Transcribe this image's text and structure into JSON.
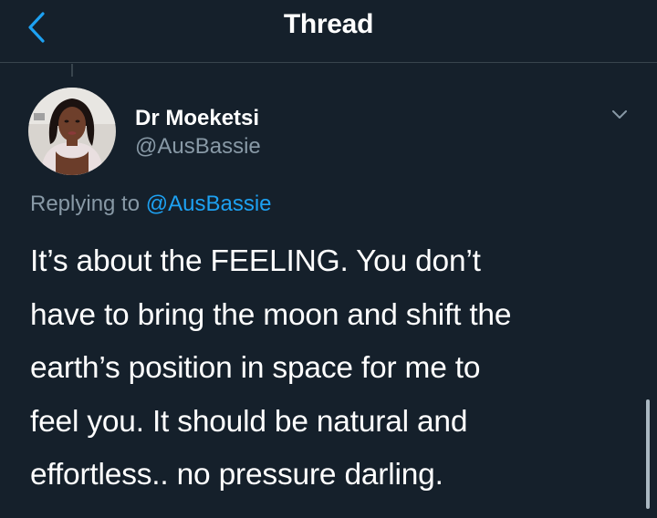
{
  "header": {
    "title": "Thread",
    "back_icon": "chevron-left-icon"
  },
  "tweet": {
    "author": {
      "display_name": "Dr Moeketsi",
      "handle": "@AusBassie"
    },
    "reply": {
      "prefix": "Replying to ",
      "to": "@AusBassie"
    },
    "text": "It’s about the FEELING. You don’t\nhave to bring the moon and shift the\nearth’s position in space for me to\nfeel you. It should be natural and\neffortless.. no pressure darling.",
    "menu_icon": "chevron-down-icon"
  },
  "colors": {
    "background": "#15202b",
    "divider": "#38444d",
    "secondary_text": "#8899a6",
    "link": "#1da1f2",
    "text": "#ffffff"
  }
}
